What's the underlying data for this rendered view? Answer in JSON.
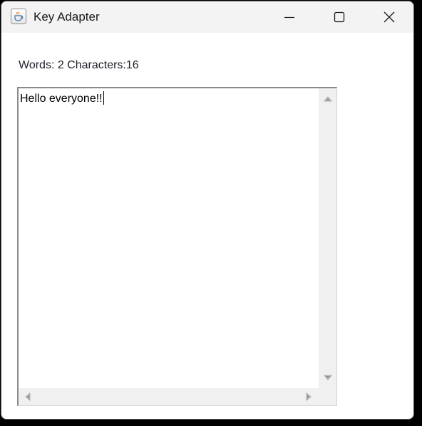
{
  "window": {
    "title": "Key Adapter",
    "icon": "java-cup-icon",
    "controls": {
      "minimize_icon": "minimize-icon",
      "maximize_icon": "maximize-icon",
      "close_icon": "close-icon"
    }
  },
  "status": {
    "text": "Words: 2 Characters:16"
  },
  "editor": {
    "content": "Hello everyone!!"
  },
  "colors": {
    "titlebar_bg": "#f3f3f3",
    "window_bg": "#ffffff",
    "scrollbar_bg": "#f0f0f0",
    "text": "#000000"
  }
}
